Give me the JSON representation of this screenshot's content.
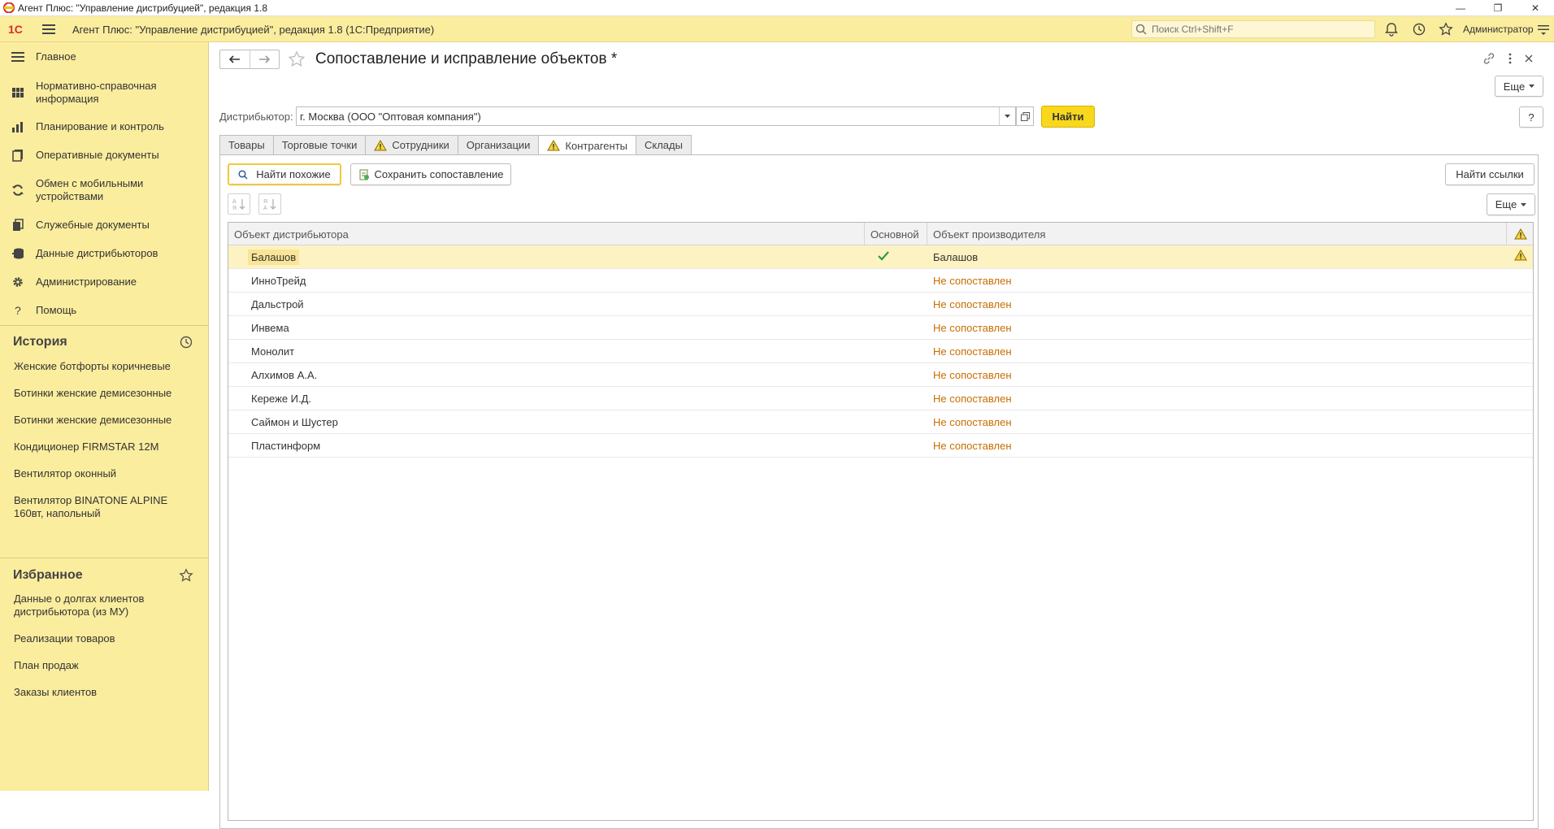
{
  "window": {
    "title": "Агент Плюс: \"Управление дистрибуцией\", редакция 1.8"
  },
  "appbar": {
    "logo_text": "1С",
    "title": "Агент Плюс: \"Управление дистрибуцией\", редакция 1.8  (1С:Предприятие)",
    "search_placeholder": "Поиск Ctrl+Shift+F",
    "user": "Администратор"
  },
  "sidebar": {
    "items": [
      {
        "label": "Главное",
        "icon": "menu-lines-icon"
      },
      {
        "label": "Нормативно-справочная информация",
        "icon": "grid-icon"
      },
      {
        "label": "Планирование и контроль",
        "icon": "bar-chart-icon"
      },
      {
        "label": "Оперативные документы",
        "icon": "documents-icon"
      },
      {
        "label": "Обмен с мобильными устройствами",
        "icon": "sync-icon"
      },
      {
        "label": "Служебные документы",
        "icon": "service-docs-icon"
      },
      {
        "label": "Данные дистрибьюторов",
        "icon": "distributor-data-icon"
      },
      {
        "label": "Администрирование",
        "icon": "gear-icon"
      },
      {
        "label": "Помощь",
        "icon": "help-icon"
      }
    ],
    "history": {
      "title": "История",
      "items": [
        "Женские ботфорты коричневые",
        "Ботинки женские демисезонные",
        "Ботинки женские демисезонные",
        "Кондиционер FIRMSTAR 12М",
        "Вентилятор оконный",
        "Вентилятор BINATONE ALPINE 160вт, напольный"
      ]
    },
    "favorites": {
      "title": "Избранное",
      "items": [
        "Данные о долгах клиентов дистрибьютора (из МУ)",
        "Реализации товаров",
        "План продаж",
        "Заказы клиентов"
      ]
    }
  },
  "form": {
    "title": "Сопоставление и исправление объектов *",
    "more_label": "Еще",
    "help_label": "?",
    "distributor_label": "Дистрибьютор:",
    "distributor_value": "г. Москва  (ООО \"Оптовая компания\")",
    "find_label": "Найти",
    "tabs": [
      {
        "label": "Товары",
        "warn": false,
        "active": false
      },
      {
        "label": "Торговые точки",
        "warn": false,
        "active": false
      },
      {
        "label": "Сотрудники",
        "warn": true,
        "active": false
      },
      {
        "label": "Организации",
        "warn": false,
        "active": false
      },
      {
        "label": "Контрагенты",
        "warn": true,
        "active": true
      },
      {
        "label": "Склады",
        "warn": false,
        "active": false
      }
    ],
    "find_similar_label": "Найти похожие",
    "save_mapping_label": "Сохранить сопоставление",
    "find_links_label": "Найти ссылки",
    "table_more_label": "Еще"
  },
  "table": {
    "columns": [
      "Объект дистрибьютора",
      "Основной",
      "Объект производителя"
    ],
    "rows": [
      {
        "distributor_object": "Балашов",
        "main": true,
        "producer_object": "Балашов",
        "mapped": true,
        "warning": true
      },
      {
        "distributor_object": "ИнноТрейд",
        "main": false,
        "producer_object": "Не сопоставлен",
        "mapped": false,
        "warning": false
      },
      {
        "distributor_object": "Дальстрой",
        "main": false,
        "producer_object": "Не сопоставлен",
        "mapped": false,
        "warning": false
      },
      {
        "distributor_object": "Инвема",
        "main": false,
        "producer_object": "Не сопоставлен",
        "mapped": false,
        "warning": false
      },
      {
        "distributor_object": "Монолит",
        "main": false,
        "producer_object": "Не сопоставлен",
        "mapped": false,
        "warning": false
      },
      {
        "distributor_object": "Алхимов А.А.",
        "main": false,
        "producer_object": "Не сопоставлен",
        "mapped": false,
        "warning": false
      },
      {
        "distributor_object": "Кереже И.Д.",
        "main": false,
        "producer_object": "Не сопоставлен",
        "mapped": false,
        "warning": false
      },
      {
        "distributor_object": "Саймон и Шустер",
        "main": false,
        "producer_object": "Не сопоставлен",
        "mapped": false,
        "warning": false
      },
      {
        "distributor_object": "Пластинформ",
        "main": false,
        "producer_object": "Не сопоставлен",
        "mapped": false,
        "warning": false
      }
    ]
  },
  "colors": {
    "sidebar_bg": "#fbed9e",
    "accent_button": "#f9d71c",
    "not_mapped_text": "#c86e00",
    "check_green": "#2e9b3a",
    "selected_row": "#fdf2c2"
  }
}
